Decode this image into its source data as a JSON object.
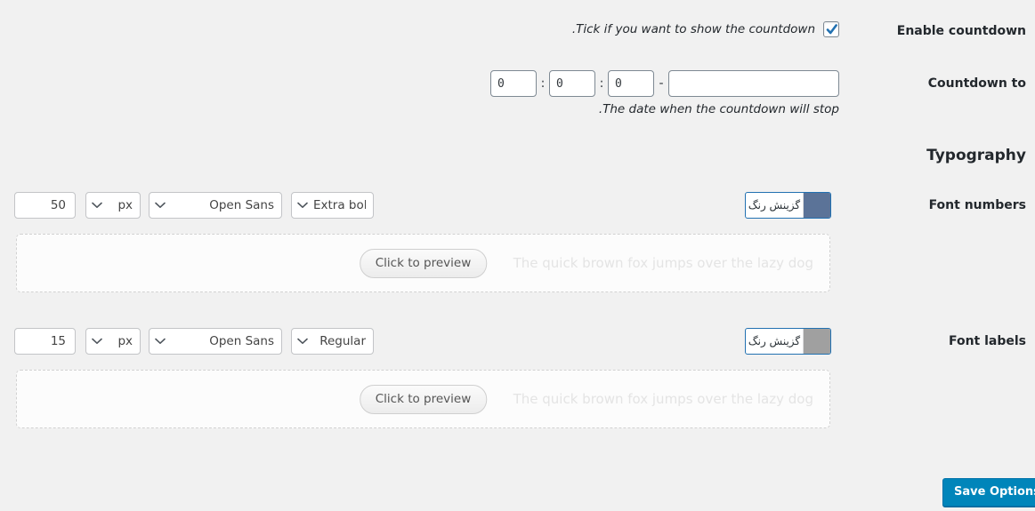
{
  "background_color": "#f1f1f1",
  "enable_countdown": {
    "label": "Enable countdown",
    "hint": ".Tick if you want to show the countdown",
    "checked": true,
    "checkbox_color": "#2271b1"
  },
  "countdown_to": {
    "label": "Countdown to",
    "hint": ".The date when the countdown will stop",
    "hours": "0",
    "minutes": "0",
    "seconds": "0",
    "separator_colon": ":",
    "separator_dash": "-",
    "date_value": "",
    "date_placeholder": ""
  },
  "typography": {
    "section_title": "Typography",
    "rows": [
      {
        "label": "Font numbers",
        "size_value": "50",
        "unit": "px",
        "family": "Open Sans",
        "weight": "Extra bold",
        "color_picker_label": "گزینش رنگ",
        "color_swatch": "#5b7398",
        "preview_text": "The quick brown fox jumps over the lazy dog",
        "preview_button": "Click to preview"
      },
      {
        "label": "Font labels",
        "size_value": "15",
        "unit": "px",
        "family": "Open Sans",
        "weight": "Regular",
        "color_picker_label": "گزینش رنگ",
        "color_swatch": "#a0a0a0",
        "preview_text": "The quick brown fox jumps over the lazy dog",
        "preview_button": "Click to preview"
      }
    ]
  },
  "footer": {
    "save_label": "Save Options",
    "save_color": "#0085ba"
  }
}
